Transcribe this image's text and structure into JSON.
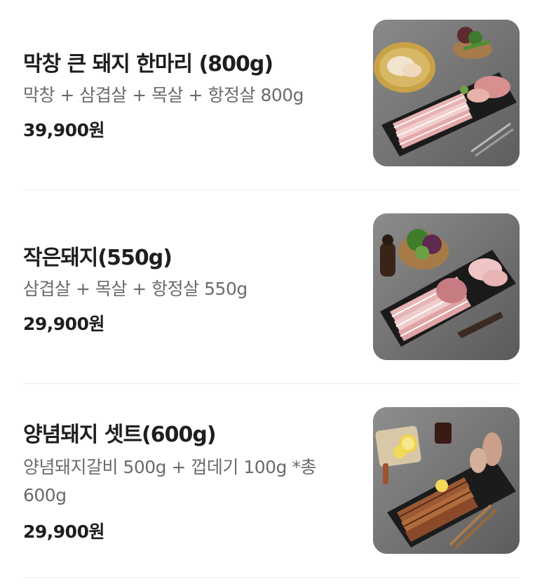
{
  "menu": {
    "items": [
      {
        "name": "막창 큰 돼지 한마리 (800g)",
        "description": "막창 + 삼겹살 + 목살 + 항정살 800g",
        "price": "39,900원",
        "image": "pork-platter-with-makchang-photo"
      },
      {
        "name": "작은돼지(550g)",
        "description": "삼겹살 + 목살 + 항정살 550g",
        "price": "29,900원",
        "image": "pork-belly-neck-platter-photo"
      },
      {
        "name": "양념돼지 셋트(600g)",
        "description": "양념돼지갈비 500g + 껍데기 100g *총 600g",
        "price": "29,900원",
        "image": "marinated-pork-ribs-platter-photo"
      }
    ]
  }
}
